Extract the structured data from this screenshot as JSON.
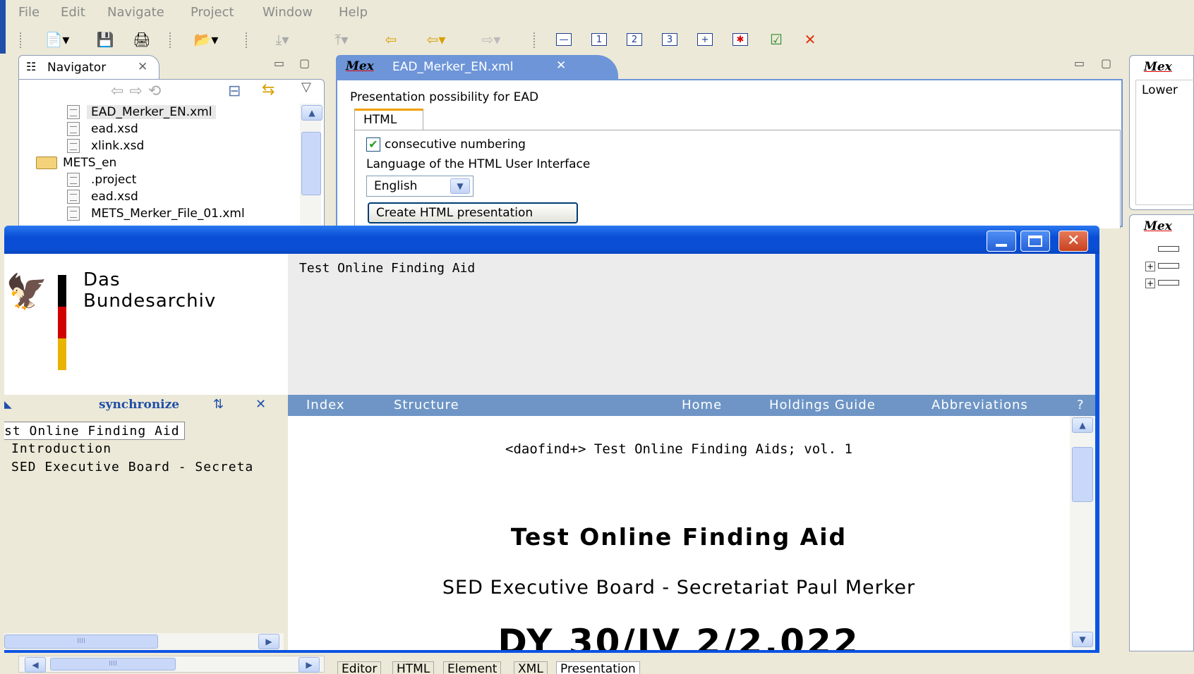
{
  "menu": [
    "File",
    "Edit",
    "Navigate",
    "Project",
    "Window",
    "Help"
  ],
  "navigator": {
    "title": "Navigator",
    "items": [
      {
        "label": "EAD_Merker_EN.xml",
        "type": "file",
        "selected": true
      },
      {
        "label": "ead.xsd",
        "type": "file"
      },
      {
        "label": "xlink.xsd",
        "type": "file"
      },
      {
        "label": "METS_en",
        "type": "folder"
      },
      {
        "label": ".project",
        "type": "file"
      },
      {
        "label": "ead.xsd",
        "type": "file"
      },
      {
        "label": "METS_Merker_File_01.xml",
        "type": "file"
      }
    ]
  },
  "editor": {
    "tab_app": "Mex",
    "tab_file": "EAD_Merker_EN.xml",
    "heading": "Presentation possibility for EAD",
    "subtab": "HTML",
    "checkbox_label": "consecutive numbering",
    "checkbox_checked": true,
    "language_label": "Language of the HTML User Interface",
    "language_value": "English",
    "create_button": "Create HTML presentation"
  },
  "right_panels": {
    "top_title": "Mex",
    "top_text": "Lower",
    "bottom_title": "Mex"
  },
  "browser": {
    "logo_line1": "Das",
    "logo_line2": "Bundesarchiv",
    "header_title": "Test Online Finding Aid",
    "sync_label": "synchronize",
    "nav": {
      "index": "Index",
      "structure": "Structure",
      "home": "Home",
      "holdings": "Holdings Guide",
      "abbreviations": "Abbreviations",
      "help": "?"
    },
    "tree": {
      "root": "st Online Finding Aid",
      "items": [
        "Introduction",
        "SED Executive Board - Secreta"
      ]
    },
    "content": {
      "series": "<daofind+> Test Online Finding Aids; vol. 1",
      "title": "Test Online Finding Aid",
      "subtitle": "SED Executive Board - Secretariat Paul Merker",
      "signature": "DY 30/IV 2/2.022"
    }
  },
  "bottom_tabs": [
    "Editor",
    "HTML",
    "Element",
    "XML",
    "Presentation"
  ],
  "colors": {
    "xp_title": "#0a54e3",
    "nav_bar": "#6e95c5",
    "eclipse_bg": "#ece9d8",
    "flag_black": "#000000",
    "flag_red": "#d00000",
    "flag_gold": "#e8b400"
  }
}
